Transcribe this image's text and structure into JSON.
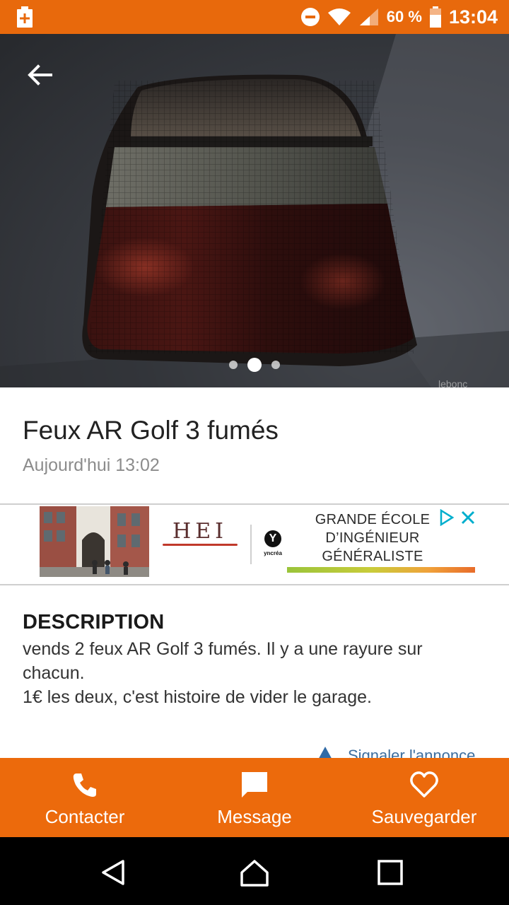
{
  "status_bar": {
    "battery_percent": "60 %",
    "time": "13:04",
    "icons": [
      "battery-plus-icon",
      "do-not-disturb-icon",
      "wifi-icon",
      "signal-icon",
      "battery-icon"
    ]
  },
  "listing": {
    "title": "Feux AR Golf 3 fumés",
    "posted": "Aujourd'hui 13:02",
    "gallery": {
      "total": 3,
      "active_index": 1
    }
  },
  "ad": {
    "brand": "HEI",
    "partner": "yncréa",
    "copy_line_1": "GRANDE ÉCOLE",
    "copy_line_2": "D’INGÉNIEUR",
    "copy_line_3": "GÉNÉRALISTE"
  },
  "description": {
    "heading": "DESCRIPTION",
    "line_1": "vends 2 feux AR Golf 3 fumés. Il y a une rayure sur chacun.",
    "line_2": "1€ les deux, c'est histoire de vider le garage."
  },
  "report": {
    "label": "Signaler l'annonce"
  },
  "actions": {
    "contact": "Contacter",
    "message": "Message",
    "save": "Sauvegarder"
  },
  "colors": {
    "brand_orange": "#ec6a0c",
    "status_bar": "#e8690c"
  }
}
